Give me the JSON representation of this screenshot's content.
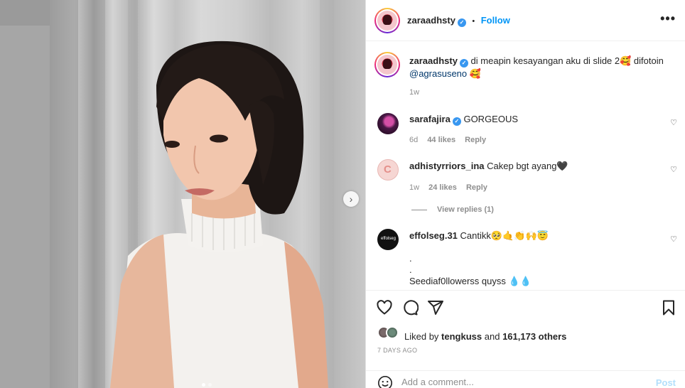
{
  "post": {
    "username": "zaraadhsty",
    "follow_label": "Follow",
    "separator": "•",
    "more_label": "•••",
    "caption": {
      "text": "di meapin kesayangan aku di slide 2🥰 difotoin",
      "mention": "@agrasuseno",
      "trailing": "🥰",
      "time": "1w"
    },
    "carousel": {
      "next_label": "›",
      "slide_count": 2,
      "current_slide": 1
    }
  },
  "comments": [
    {
      "username": "sarafajira",
      "verified": true,
      "text": "GORGEOUS",
      "time": "6d",
      "likes": "44 likes",
      "reply": "Reply"
    },
    {
      "username": "adhistyrriors_ina",
      "verified": false,
      "text": "Cakep bgt ayang🖤",
      "time": "1w",
      "likes": "24 likes",
      "reply": "Reply",
      "view_replies": "View replies (1)"
    },
    {
      "username": "effolseg.31",
      "verified": false,
      "text": "Cantikk🥺🤙👏🙌😇",
      "line2": ".",
      "line3": ".",
      "line4": "Seediaf0llowerss quyss 💧💧"
    }
  ],
  "actions": {
    "liked_by_prefix": "Liked by",
    "liked_by_user": "tengkuss",
    "liked_by_mid": "and",
    "liked_by_count": "161,173 others",
    "date": "7 DAYS AGO",
    "comment_placeholder": "Add a comment...",
    "post_label": "Post"
  },
  "icons": {
    "heart": "heart-icon",
    "comment": "comment-icon",
    "share": "share-icon",
    "save": "bookmark-icon",
    "emoji": "emoji-icon"
  },
  "colors": {
    "accent": "#0095f6",
    "verified": "#3897f0",
    "muted": "#8e8e8e",
    "text": "#262626"
  }
}
